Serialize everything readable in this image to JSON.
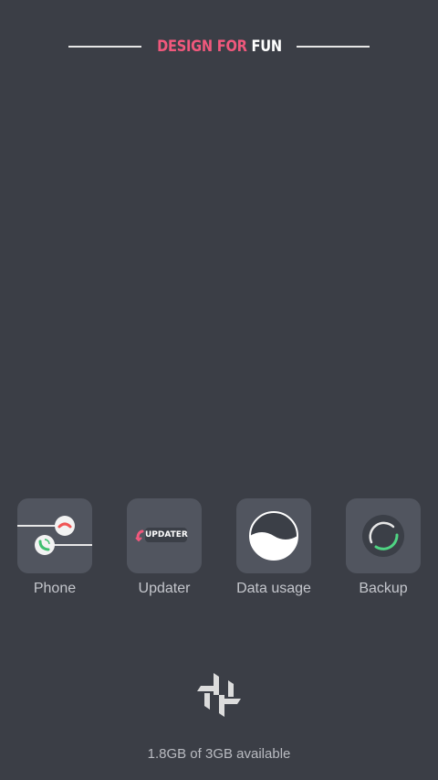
{
  "header": {
    "accent_text": "DESIGN FOR",
    "plain_text": "FUN"
  },
  "apps": [
    {
      "label": "Phone",
      "icon": "phone-icon"
    },
    {
      "label": "Updater",
      "icon": "updater-icon",
      "badge_text": "UPDATER"
    },
    {
      "label": "Data usage",
      "icon": "data-usage-icon"
    },
    {
      "label": "Backup",
      "icon": "backup-icon"
    }
  ],
  "bottom_logo_icon": "theme-logo-icon",
  "storage": {
    "text": "1.8GB of 3GB available"
  },
  "colors": {
    "background": "#3b3e46",
    "tile": "#51555f",
    "accent": "#f0587c",
    "green": "#4fd483",
    "red": "#f05454"
  }
}
